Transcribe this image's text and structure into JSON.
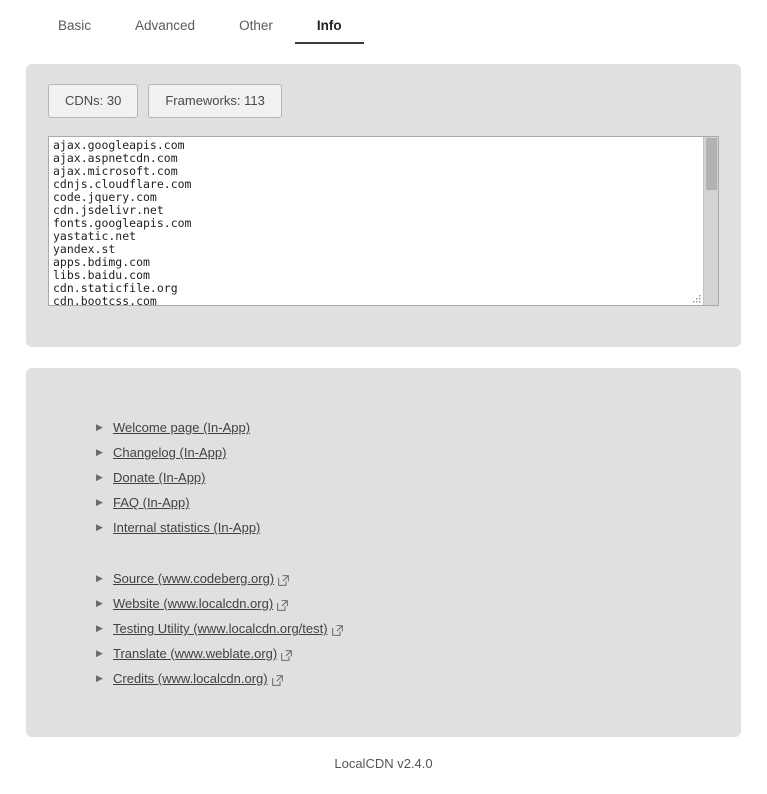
{
  "tabs": [
    {
      "label": "Basic",
      "active": false
    },
    {
      "label": "Advanced",
      "active": false
    },
    {
      "label": "Other",
      "active": false
    },
    {
      "label": "Info",
      "active": true
    }
  ],
  "counters": {
    "cdns_label": "CDNs: 30",
    "frameworks_label": "Frameworks: 113"
  },
  "cdn_list": {
    "lines": [
      "ajax.googleapis.com",
      "ajax.aspnetcdn.com",
      "ajax.microsoft.com",
      "cdnjs.cloudflare.com",
      "code.jquery.com",
      "cdn.jsdelivr.net",
      "fonts.googleapis.com",
      "yastatic.net",
      "yandex.st",
      "apps.bdimg.com",
      "libs.baidu.com",
      "cdn.staticfile.org",
      "cdn.bootcss.com"
    ]
  },
  "links": {
    "bullet_glyph": "▶",
    "in_app": [
      {
        "label": "Welcome page (In-App)"
      },
      {
        "label": "Changelog (In-App)"
      },
      {
        "label": "Donate (In-App)"
      },
      {
        "label": "FAQ (In-App)"
      },
      {
        "label": "Internal statistics (In-App)"
      }
    ],
    "external": [
      {
        "label": "Source (www.codeberg.org)"
      },
      {
        "label": "Website (www.localcdn.org)"
      },
      {
        "label": "Testing Utility (www.localcdn.org/test)"
      },
      {
        "label": "Translate (www.weblate.org)"
      },
      {
        "label": "Credits (www.localcdn.org)"
      }
    ]
  },
  "footer": {
    "text": "LocalCDN v2.4.0"
  },
  "colors": {
    "panel_bg": "#e0e0e0",
    "page_bg": "#ffffff",
    "text": "#3c3c3c",
    "link": "#424242",
    "active_tab": "#222222"
  }
}
